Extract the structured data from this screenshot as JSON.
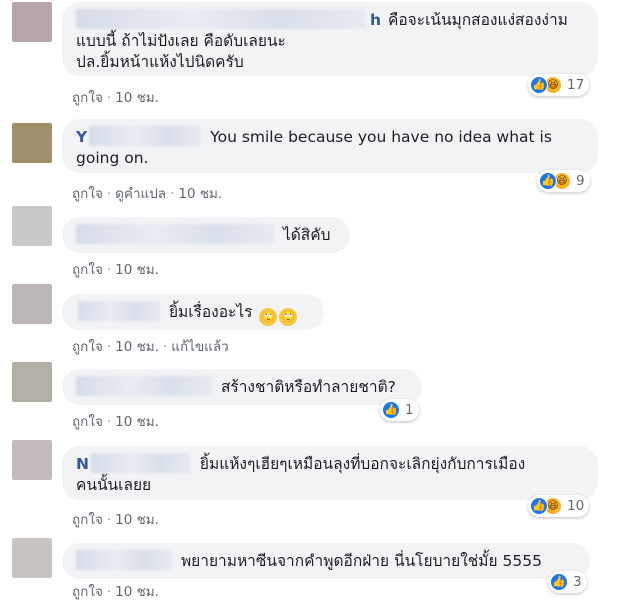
{
  "comments": [
    {
      "name_visible": "h",
      "text": "คือจะเน้นมุกสองแง่สองง่าม แบบนี้ ถ้าไม่ปังเลย คือดับเลยนะ ปล.ยิ้มหน้าแห้งไปนิดครับ",
      "line1": "คือจะเน้นมุกสองแง่สองง่าม",
      "line2": "แบบนี้ ถ้าไม่ปังเลย คือดับเลยนะ",
      "line3": "ปล.ยิ้มหน้าแห้งไปนิดครับ",
      "like": "ถูกใจ",
      "time": "10 ชม.",
      "reactions": {
        "icons": [
          "like-icon",
          "haha-icon"
        ],
        "count": "17"
      },
      "avatar_color": "#b6a4a8"
    },
    {
      "name_visible": "Y",
      "line1": "You smile because you have no idea what is",
      "line2": "going on.",
      "like": "ถูกใจ",
      "translate": "ดูคำแปล",
      "time": "10 ชม.",
      "reactions": {
        "icons": [
          "like-icon",
          "haha-icon"
        ],
        "count": "9"
      },
      "avatar_color": "#a08f6b"
    },
    {
      "line1": "ได้สิคับ",
      "like": "ถูกใจ",
      "time": "10 ชม.",
      "avatar_color": "#c9c9c9"
    },
    {
      "name_visible": "",
      "line1": "ยิ้มเรื่องอะไร",
      "emoji": [
        "rolling-eyes-icon",
        "rolling-eyes-icon"
      ],
      "like": "ถูกใจ",
      "time": "10 ชม.",
      "edited": "แก้ไขแล้ว",
      "avatar_color": "#bdb7b7"
    },
    {
      "line1": "สร้างชาติหรือทำลายชาติ?",
      "like": "ถูกใจ",
      "time": "10 ชม.",
      "reactions": {
        "icons": [
          "like-icon"
        ],
        "count": "1"
      },
      "avatar_color": "#b4b0a8"
    },
    {
      "name_visible": "N",
      "line1": "ยิ้มแห้งๆเฮียๆเหมือนลุงที่บอกจะเลิกยุ่งกับการเมือง",
      "line2": "คนนั้นเลยย",
      "like": "ถูกใจ",
      "time": "10 ชม.",
      "reactions": {
        "icons": [
          "like-icon",
          "haha-icon"
        ],
        "count": "10"
      },
      "avatar_color": "#c2babb"
    },
    {
      "line1": "พยายามหาซีนจากคำพูดอีกฝ่าย นี่นโยบายใช่มั้ย 5555",
      "like": "ถูกใจ",
      "time": "10 ชม.",
      "reactions": {
        "icons": [
          "like-icon"
        ],
        "count": "3"
      },
      "avatar_color": "#c8c4bf"
    }
  ],
  "colors": {
    "bubble": "#f2f3f5",
    "like_blue": "#1877f2",
    "haha_yellow": "#f7b125",
    "meta_gray": "#606770"
  }
}
